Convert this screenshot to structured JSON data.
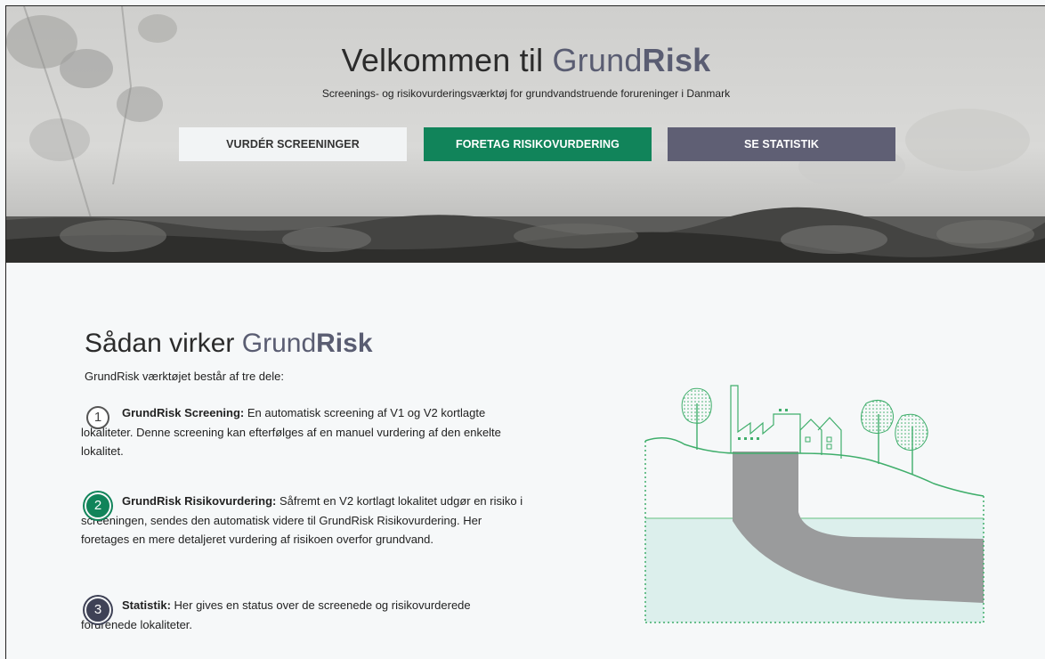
{
  "hero": {
    "title_prefix": "Velkommen til ",
    "brand_light": "Grund",
    "brand_bold": "Risk",
    "subtitle": "Screenings- og risikovurderingsværktøj for grundvandstruende forureninger i Danmark",
    "buttons": [
      {
        "label": "VURDÉR SCREENINGER"
      },
      {
        "label": "FORETAG RISIKOVURDERING"
      },
      {
        "label": "SE STATISTIK"
      }
    ]
  },
  "how": {
    "title_prefix": "Sådan virker ",
    "brand_light": "Grund",
    "brand_bold": "Risk",
    "intro": "GrundRisk værktøjet består af tre dele:",
    "steps": [
      {
        "num": "1",
        "label": "GrundRisk Screening:",
        "text": " En automatisk screening af V1 og V2 kortlagte lokaliteter. Denne screening kan efterfølges af en manuel vurdering af den enkelte lokalitet."
      },
      {
        "num": "2",
        "label": "GrundRisk Risikovurdering:",
        "text": " Såfremt en V2 kortlagt lokalitet udgør en risiko i screeningen, sendes den automatisk videre til GrundRisk Risikovurdering. Her foretages en mere detaljeret vurdering af risikoen overfor grundvand."
      },
      {
        "num": "3",
        "label": "Statistik:",
        "text": " Her gives en status over de screenede og risikovurderede forurenede lokaliteter."
      }
    ]
  },
  "colors": {
    "accent_green": "#11845a",
    "accent_slate": "#5f5f74",
    "brand_text": "#5a5d72"
  },
  "icons": {
    "illustration": "contamination-plume-illustration"
  }
}
